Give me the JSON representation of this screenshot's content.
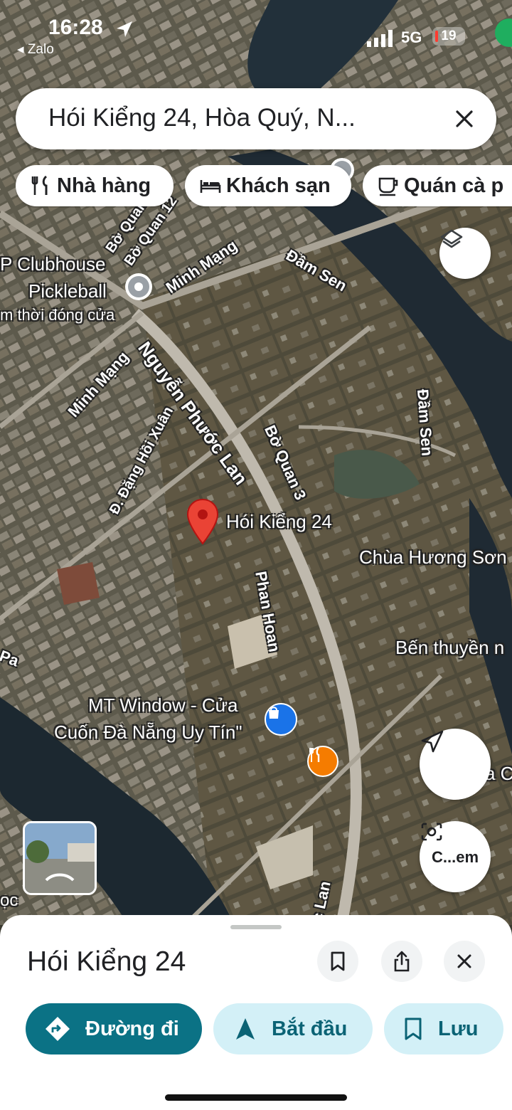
{
  "status_bar": {
    "time": "16:28",
    "back_app": "Zalo",
    "network": "5G",
    "battery": "19"
  },
  "search": {
    "query": "Hói Kiểng 24, Hòa Quý, N..."
  },
  "chips": [
    {
      "label": "Nhà hàng",
      "icon": "restaurant-icon"
    },
    {
      "label": "Khách sạn",
      "icon": "hotel-icon"
    },
    {
      "label": "Quán cà p",
      "icon": "coffee-icon"
    }
  ],
  "map": {
    "pin_label": "Hói Kiểng 24",
    "places": {
      "clubhouse_line1": "P Clubhouse",
      "clubhouse_line2": "Pickleball",
      "clubhouse_status": "m thời đóng cửa",
      "temple": "Chùa Hương Sơn",
      "dock": "Bến thuyền n",
      "shop_line1": "MT Window - Cửa",
      "shop_line2": "Cuốn Đà Nẵng Uy Tín\"",
      "edge_left_bottom": "ọc",
      "edge_right_bottom": "a C"
    },
    "roads": {
      "nguyen_phuoc_lan": "Nguyễn Phước Lan",
      "minh_mang_1": "Minh Mạng",
      "minh_mang_2": "Minh Mạng",
      "dam_sen_1": "Đầm Sen",
      "dam_sen_2": "Đầm Sen",
      "bo_quan_3": "Bờ Quan 3",
      "bo_quan_12": "Bờ Quan 12",
      "bo_quan": "Bờ Quan",
      "dang_hoi_xuan": "Đ. Đặng Hồi Xuân",
      "phan_hoan": "Phan Hoan",
      "lan_bottom": "c Lan",
      "pa_left": "Pa"
    },
    "street_view_button": "C...em"
  },
  "sheet": {
    "title": "Hói Kiểng 24",
    "directions_label": "Đường đi",
    "start_label": "Bắt đầu",
    "save_label": "Lưu"
  },
  "colors": {
    "primary": "#0b7285",
    "secondary_bg": "#d3f0f7",
    "pin": "#ea4335"
  }
}
